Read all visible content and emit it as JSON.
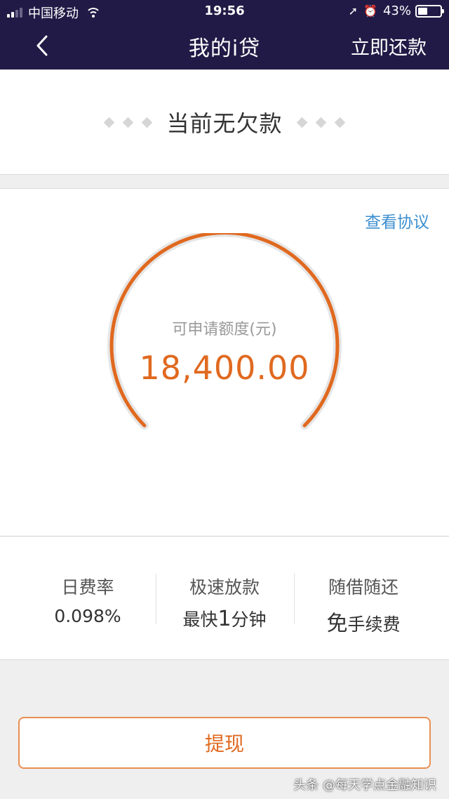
{
  "status_bar": {
    "carrier": "中国移动",
    "time": "19:56",
    "battery": "43%",
    "battery_level": 0.43,
    "icons": [
      "signal-icon",
      "wifi-icon",
      "location-arrow-icon",
      "alarm-icon",
      "battery-icon"
    ]
  },
  "nav": {
    "title": "我的i贷",
    "action": "立即还款"
  },
  "debt": {
    "status": "当前无欠款"
  },
  "quota": {
    "agreement_link": "查看协议",
    "label": "可申请额度(元)",
    "amount": "18,400.00"
  },
  "features": [
    {
      "title": "日费率",
      "value": "0.098%"
    },
    {
      "title": "极速放款",
      "value_pre": "最快",
      "value_emph": "1",
      "value_post": "分钟"
    },
    {
      "title": "随借随还",
      "value_emph": "免",
      "value_post": "手续费"
    }
  ],
  "withdraw": {
    "label": "提现"
  },
  "watermark": "头条 @每天学点金融知识",
  "colors": {
    "header_bg": "#221a46",
    "accent_orange": "#e0691f",
    "link_blue": "#3c8fd0",
    "gauge_track": "#e6e6e6"
  }
}
